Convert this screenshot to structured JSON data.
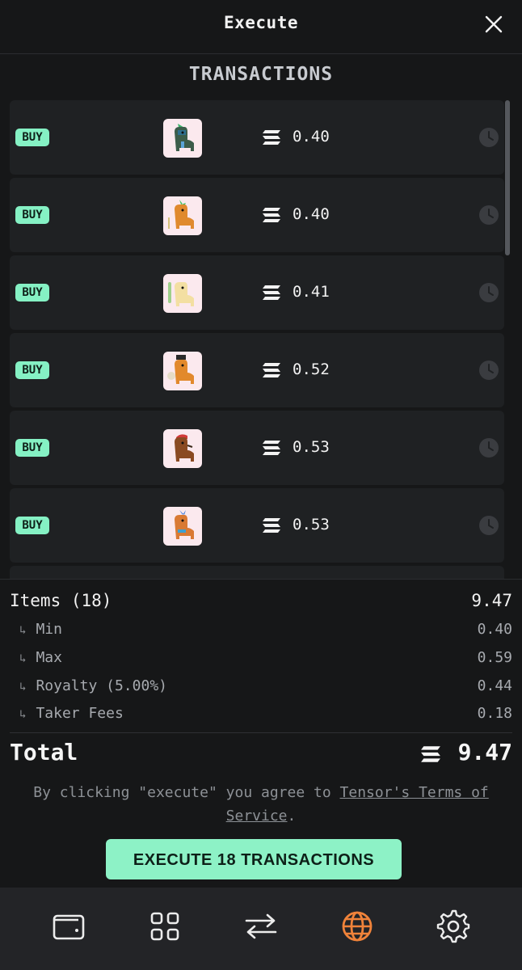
{
  "header": {
    "title": "Execute",
    "close_icon": "close-icon"
  },
  "section_title": "TRANSACTIONS",
  "transactions": [
    {
      "badge": "BUY",
      "price": "0.40",
      "image": "llama-green-teal"
    },
    {
      "badge": "BUY",
      "price": "0.40",
      "image": "llama-orange-crown"
    },
    {
      "badge": "BUY",
      "price": "0.41",
      "image": "llama-cream"
    },
    {
      "badge": "BUY",
      "price": "0.52",
      "image": "llama-orange-hat"
    },
    {
      "badge": "BUY",
      "price": "0.53",
      "image": "llama-brown-cap"
    },
    {
      "badge": "BUY",
      "price": "0.53",
      "image": "llama-orange-punk"
    }
  ],
  "summary": {
    "items_label": "Items (18)",
    "items_value": "9.47",
    "min_label": "Min",
    "min_value": "0.40",
    "max_label": "Max",
    "max_value": "0.59",
    "royalty_label": "Royalty (5.00%)",
    "royalty_value": "0.44",
    "taker_label": "Taker Fees",
    "taker_value": "0.18",
    "sub_arrow": "↳"
  },
  "total": {
    "label": "Total",
    "value": "9.47"
  },
  "terms": {
    "prefix": "By clicking \"execute\" you agree to ",
    "link": "Tensor's Terms of Service",
    "suffix": "."
  },
  "execute_button": "EXECUTE 18 TRANSACTIONS",
  "nav": [
    {
      "icon": "wallet-icon"
    },
    {
      "icon": "grid-icon"
    },
    {
      "icon": "swap-icon"
    },
    {
      "icon": "globe-icon",
      "active": true
    },
    {
      "icon": "settings-icon"
    }
  ],
  "colors": {
    "accent_green": "#85f1c4",
    "active_nav": "#f0833a",
    "background": "#161718"
  }
}
